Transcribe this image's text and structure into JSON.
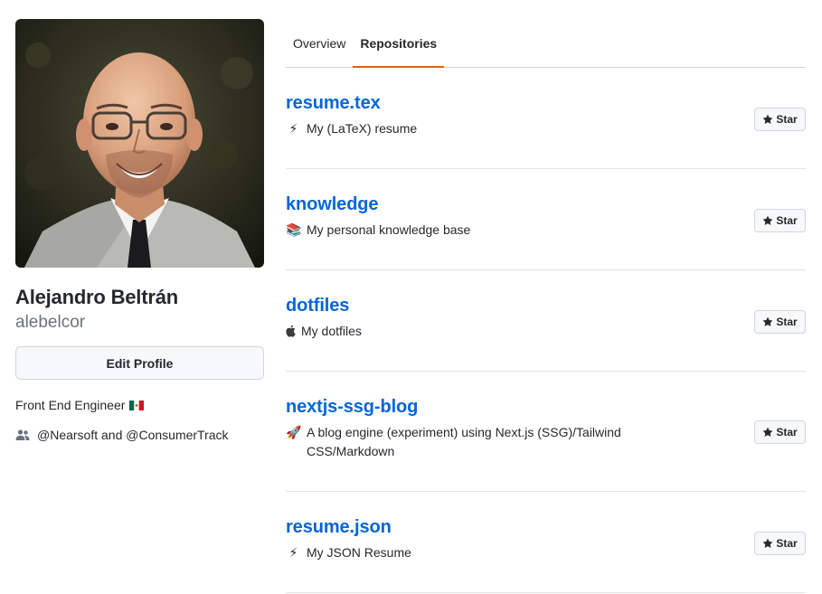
{
  "profile": {
    "full_name": "Alejandro Beltrán",
    "username": "alebelcor",
    "edit_button": "Edit Profile",
    "bio": "Front End Engineer",
    "bio_icon": "mexico-flag-icon",
    "company": "@Nearsoft and @ConsumerTrack",
    "company_icon": "people-icon"
  },
  "tabs": [
    {
      "label": "Overview",
      "active": false
    },
    {
      "label": "Repositories",
      "active": true
    }
  ],
  "colors": {
    "link": "#0366d6",
    "active_tab_underline": "#e36209",
    "muted_text": "#6a737d"
  },
  "repos": [
    {
      "name": "resume.tex",
      "emoji": "⚡",
      "description": "My (LaTeX) resume",
      "star_label": "Star"
    },
    {
      "name": "knowledge",
      "emoji": "📚",
      "description": "My personal knowledge base",
      "star_label": "Star"
    },
    {
      "name": "dotfiles",
      "emoji": "",
      "description": "My dotfiles",
      "star_label": "Star"
    },
    {
      "name": "nextjs-ssg-blog",
      "emoji": "🚀",
      "description": "A blog engine (experiment) using Next.js (SSG)/Tailwind CSS/Markdown",
      "star_label": "Star"
    },
    {
      "name": "resume.json",
      "emoji": "⚡",
      "description": "My JSON Resume",
      "star_label": "Star"
    }
  ]
}
